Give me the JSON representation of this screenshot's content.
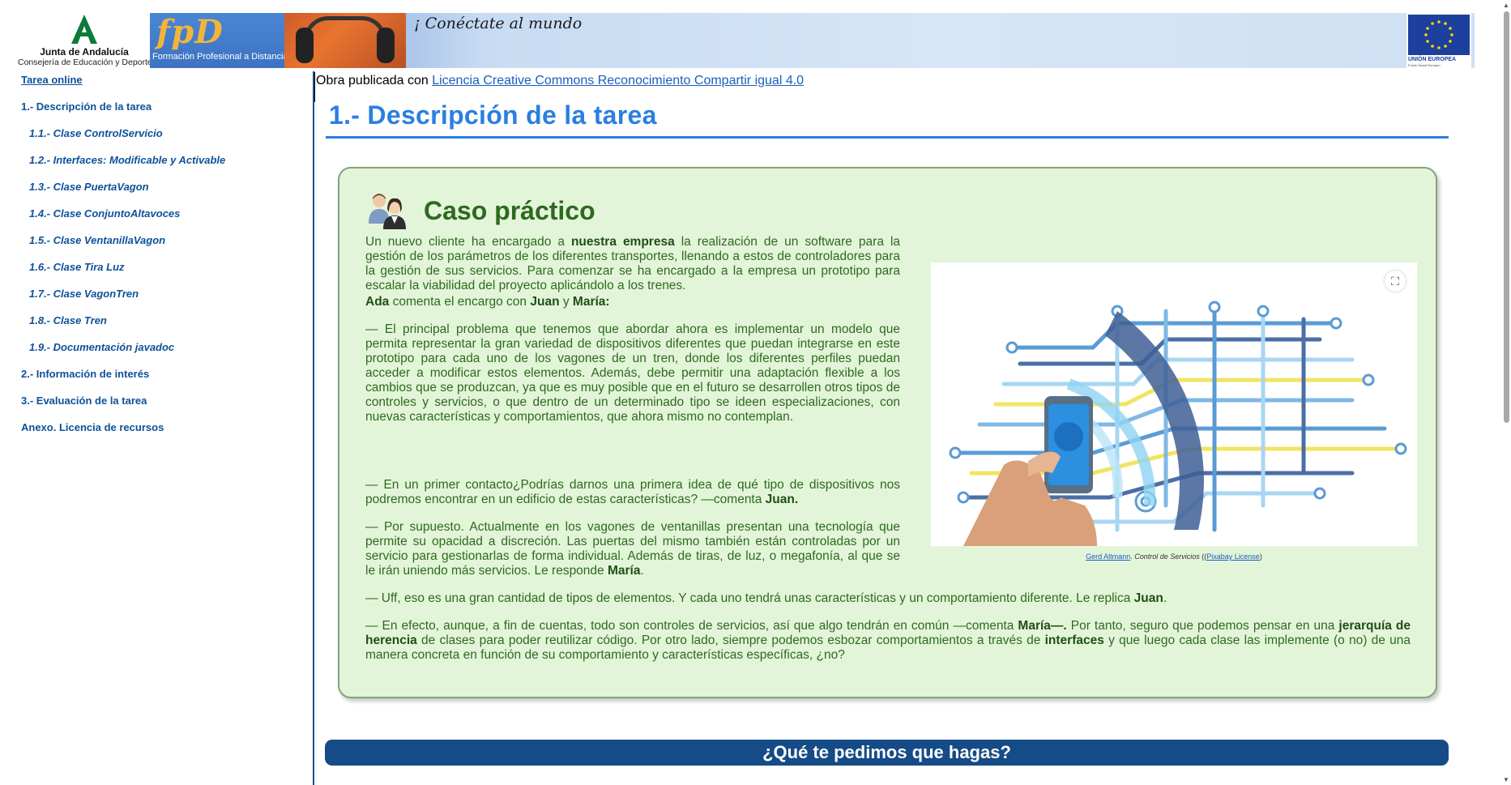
{
  "header": {
    "junta_name": "Junta de Andalucía",
    "junta_sub": "Consejería de Educación y Deporte",
    "fp_letters": "fpD",
    "fp_sub": "Formación Profesional a Distancia",
    "slogan": "¡ Conéctate al mundo",
    "eu_text": "UNIÓN EUROPEA",
    "eu_subtext": "Fondo Social Europeo"
  },
  "sidebar": {
    "items": [
      {
        "label": "Tarea online"
      },
      {
        "label": "1.- Descripción de la tarea"
      },
      {
        "label": "1.1.- Clase ControlServicio"
      },
      {
        "label": "1.2.- Interfaces: Modificable y Activable"
      },
      {
        "label": "1.3.- Clase PuertaVagon"
      },
      {
        "label": "1.4.- Clase ConjuntoAltavoces"
      },
      {
        "label": "1.5.- Clase VentanillaVagon"
      },
      {
        "label": "1.6.- Clase Tira Luz"
      },
      {
        "label": "1.7.- Clase VagonTren"
      },
      {
        "label": "1.8.- Clase Tren"
      },
      {
        "label": "1.9.- Documentación javadoc"
      },
      {
        "label": "2.- Información de interés"
      },
      {
        "label": "3.- Evaluación de la tarea"
      },
      {
        "label": "Anexo. Licencia de recursos"
      }
    ]
  },
  "main": {
    "license_prefix": "Obra publicada con ",
    "license_link": "Licencia Creative Commons Reconocimiento Compartir igual 4.0",
    "title": "1.- Descripción de la tarea",
    "case": {
      "title": "Caso práctico",
      "p1": {
        "a": "Un nuevo cliente ha encargado a ",
        "b": "nuestra empresa",
        "c": " la realización de un software para la gestión de los parámetros de los diferentes transportes, llenando a estos de controladores para la gestión  de sus servicios. Para comenzar se ha  encargado a la empresa un prototipo para escalar la viabilidad del proyecto aplicándolo a los trenes."
      },
      "p2": {
        "a": "Ada",
        "b": " comenta el encargo con ",
        "c": "Juan",
        "d": " y ",
        "e": "María:"
      },
      "p3": "— El principal problema que tenemos que abordar ahora es implementar un modelo que permita representar la gran variedad de dispositivos diferentes que puedan integrarse en este prototipo para cada uno de los vagones de un tren, donde los diferentes perfiles puedan acceder a modificar  estos  elementos. Además, debe permitir una adaptación flexible a los cambios que se produzcan, ya que es muy posible que en el futuro se desarrollen otros tipos de controles y servicios, o que dentro de un determinado tipo se ideen especializaciones, con nuevas características y comportamientos, que ahora mismo no contemplan.",
      "p4": {
        "a": "— En un primer contacto¿Podrías darnos una  primera idea de qué tipo de dispositivos nos podremos encontrar en un edificio de estas características? —comenta ",
        "b": "Juan."
      },
      "p5": {
        "a": "— Por supuesto. Actualmente en los vagones de ventanillas presentan una tecnología que permite su opacidad a discreción. Las puertas del mismo también están controladas por un servicio para gestionarlas de forma individual. Además de tiras, de luz, o megafonía, al que se le irán uniendo más servicios. Le responde ",
        "b": "María",
        "c": "."
      },
      "p6": {
        "a": "— Uff, eso es una gran cantidad de tipos de elementos. Y cada uno tendrá unas características y un comportamiento diferente. Le replica ",
        "b": "Juan",
        "c": "."
      },
      "p7": {
        "a": "— En efecto, aunque, a fin de cuentas, todo son controles de servicios, así que algo tendrán en común —comenta ",
        "b": "María—.",
        "c": "  Por tanto, seguro que podemos pensar en una ",
        "d": "jerarquía de herencia",
        "e": " de clases para poder reutilizar código. Por otro lado, siempre podemos esbozar comportamientos a través de ",
        "f": "interfaces",
        "g": " y que luego cada clase las implemente (o no) de una manera concreta en función de su comportamiento y características específicas, ¿no?"
      },
      "caption": {
        "author": "Gerd Altmann",
        "sep1": ". ",
        "work": "Control de Servicios",
        "open": " ((",
        "license": "Pixabay License",
        "close": ")"
      }
    },
    "section_bar": "¿Qué te pedimos que hagas?"
  },
  "colors": {
    "link": "#0d5199",
    "title": "#2a7fe0",
    "case_bg": "#e3f5d9",
    "case_text": "#2d6a1f",
    "section_bar": "#154b86"
  },
  "icons": [
    "junta-logo-icon",
    "eu-flag-icon",
    "characters-icon",
    "expand-icon"
  ]
}
